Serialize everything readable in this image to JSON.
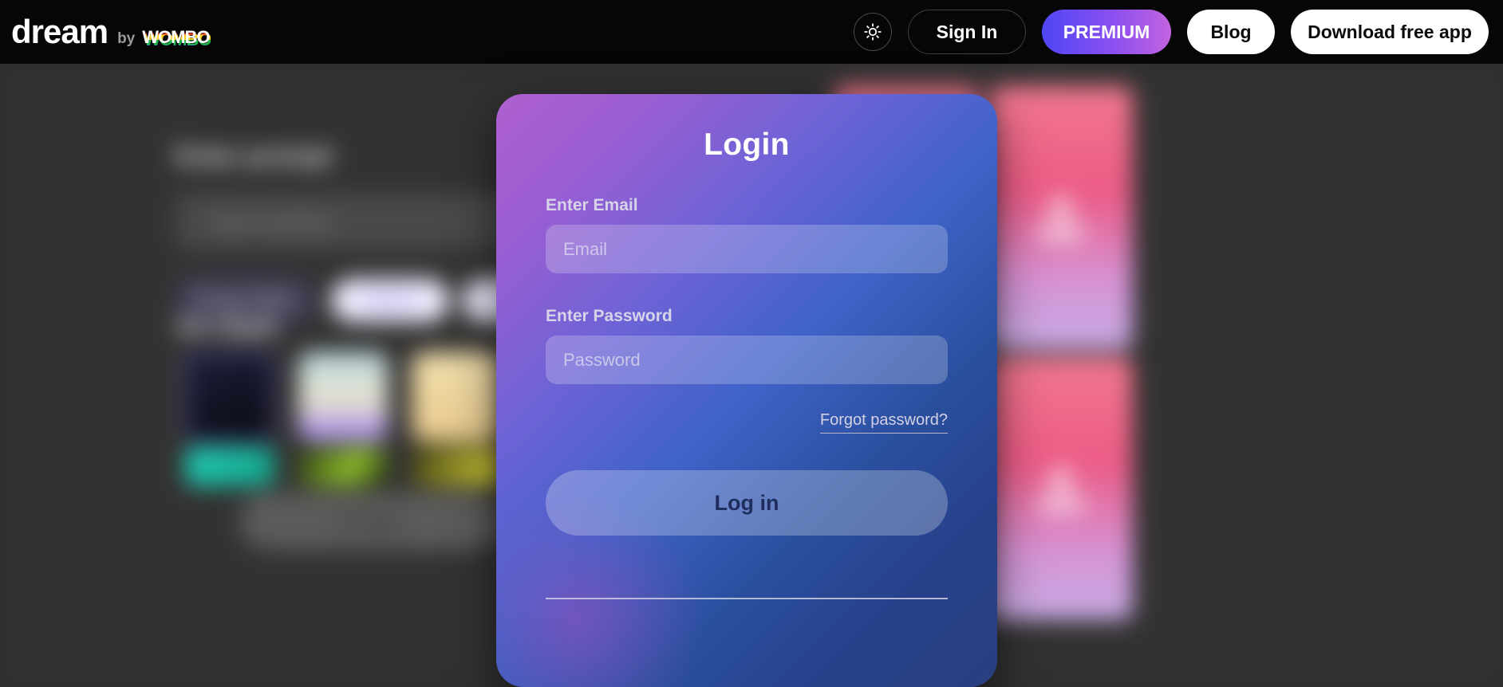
{
  "header": {
    "logo": {
      "name": "dream",
      "by": "by",
      "brand": "WOMBO"
    },
    "brightness_icon": "sun-brightness-icon",
    "sign_in_label": "Sign In",
    "premium_label": "PREMIUM",
    "premium_gradient_from": "#4f46f5",
    "premium_gradient_to": "#c264e0",
    "blog_label": "Blog",
    "download_label": "Download free app",
    "background": "#060606"
  },
  "modal": {
    "title": "Login",
    "email_label": "Enter Email",
    "email_placeholder": "Email",
    "email_value": "",
    "password_label": "Enter Password",
    "password_placeholder": "Password",
    "password_value": "",
    "forgot_label": "Forgot password?",
    "login_label": "Log in",
    "gradient_from": "#b060cf",
    "gradient_to": "#27408a"
  },
  "background_page": {
    "prompt_label": "Enter prompt",
    "prompt_placeholder": "Type anything",
    "art_style_label": "Art Style",
    "art_preview_label": "Art Preview",
    "create_label": "Create",
    "chips": [
      {
        "label": "Prompt Helper",
        "style": "outline"
      },
      {
        "label": "Upload",
        "style": "solid"
      },
      {
        "label": "Mix",
        "style": "solid2"
      }
    ],
    "art_styles": [
      {
        "caption": "Dreamland v3"
      },
      {
        "caption": "Minimalism v3 XL"
      },
      {
        "caption": "Realistic"
      }
    ]
  }
}
